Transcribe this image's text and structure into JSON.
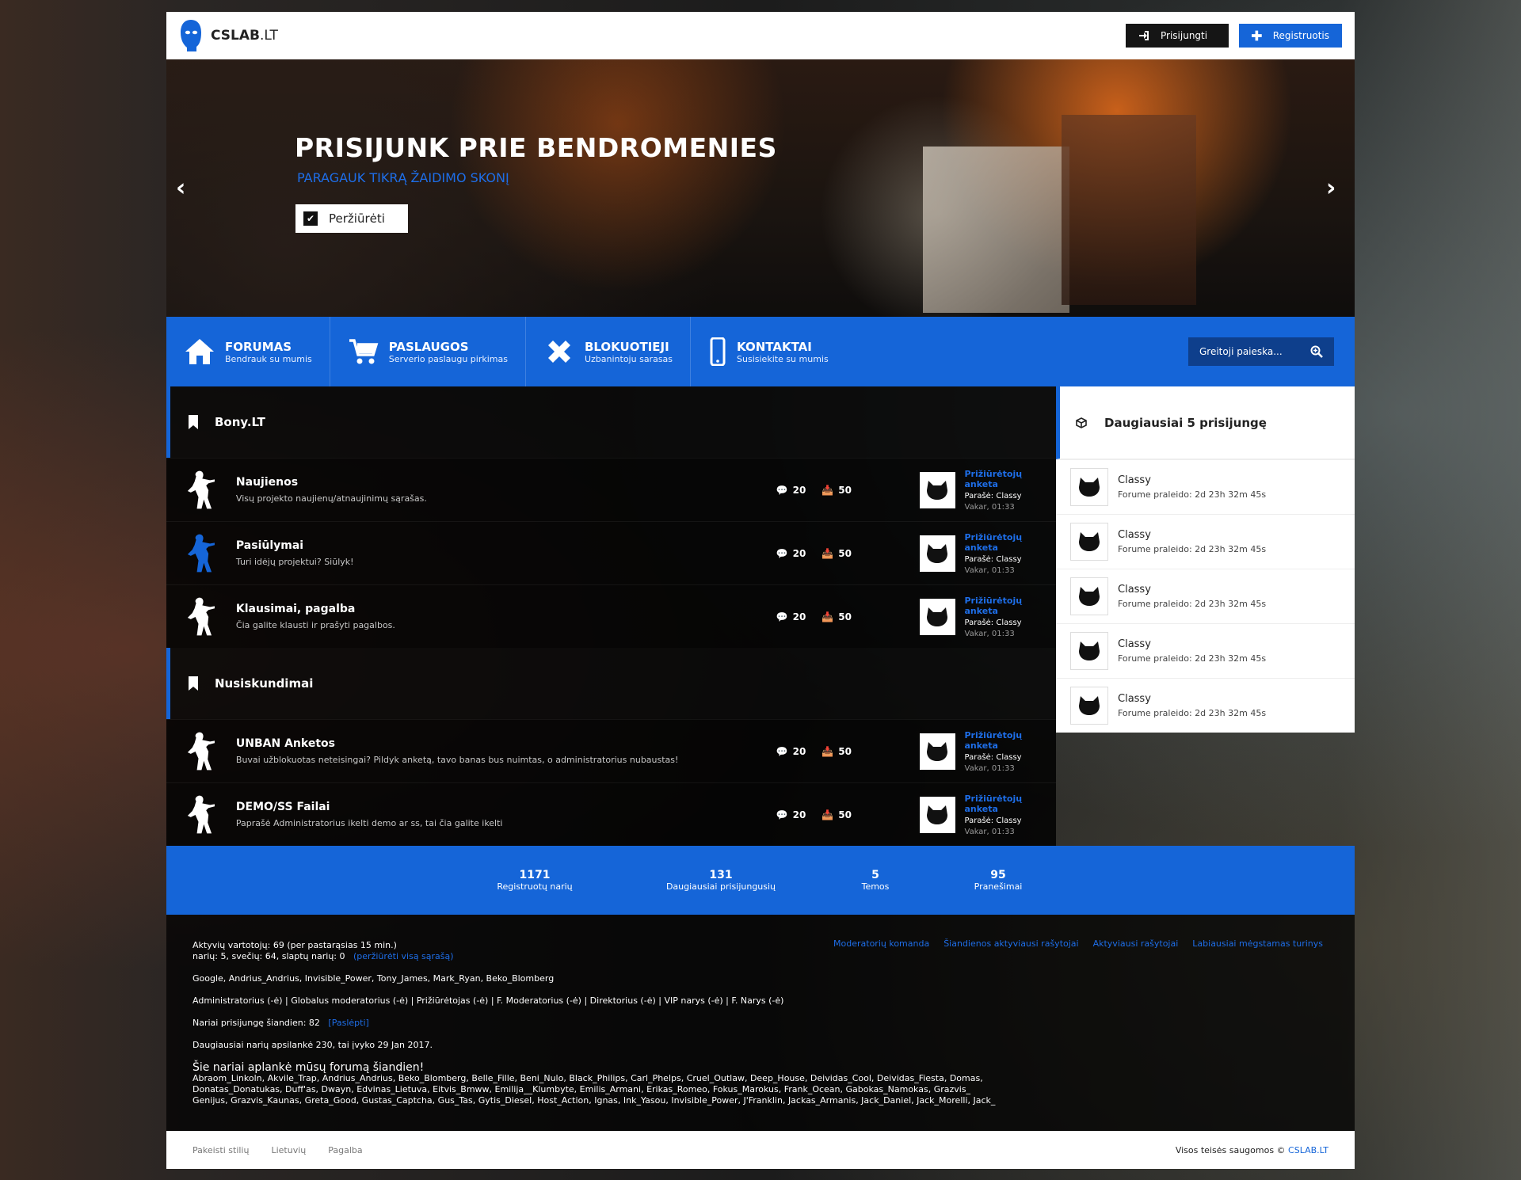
{
  "header": {
    "logo_main": "CSLAB",
    "logo_suffix": ".LT",
    "login_label": "Prisijungti",
    "register_label": "Registruotis"
  },
  "hero": {
    "title": "PRISIJUNK PRIE BENDROMENIES",
    "subtitle": "PARAGAUK TIKRĄ ŽAIDIMO SKONĮ",
    "button_label": "Peržiūrėti"
  },
  "nav": {
    "items": [
      {
        "title": "FORUMAS",
        "subtitle": "Bendrauk su mumis"
      },
      {
        "title": "PASLAUGOS",
        "subtitle": "Serverio paslaugu pirkimas"
      },
      {
        "title": "BLOKUOTIEJI",
        "subtitle": "Uzbanintoju sarasas"
      },
      {
        "title": "KONTAKTAI",
        "subtitle": "Susisiekite su mumis"
      }
    ],
    "search_placeholder": "Greitoji paieska..."
  },
  "categories": [
    {
      "title": "Bony.LT",
      "forums": [
        {
          "name": "Naujienos",
          "desc": "Visų projekto naujienų/atnaujinimų sąrašas.",
          "topics": "20",
          "posts": "50",
          "last_title": "Prižiūrėtojų anketa",
          "last_author": "Parašė: Classy",
          "last_time": "Vakar, 01:33"
        },
        {
          "name": "Pasiūlymai",
          "desc": "Turi idėjų projektui? Siūlyk!",
          "topics": "20",
          "posts": "50",
          "last_title": "Prižiūrėtojų anketa",
          "last_author": "Parašė: Classy",
          "last_time": "Vakar, 01:33"
        },
        {
          "name": "Klausimai, pagalba",
          "desc": "Čia galite klausti ir prašyti pagalbos.",
          "topics": "20",
          "posts": "50",
          "last_title": "Prižiūrėtojų anketa",
          "last_author": "Parašė: Classy",
          "last_time": "Vakar, 01:33"
        }
      ]
    },
    {
      "title": "Nusiskundimai",
      "forums": [
        {
          "name": "UNBAN Anketos",
          "desc": "Buvai užblokuotas neteisingai? Pildyk anketą, tavo banas bus nuimtas, o administratorius nubaustas!",
          "topics": "20",
          "posts": "50",
          "last_title": "Prižiūrėtojų anketa",
          "last_author": "Parašė: Classy",
          "last_time": "Vakar, 01:33"
        },
        {
          "name": "DEMO/SS Failai",
          "desc": "Paprašė Administratorius ikelti demo ar ss, tai čia galite ikelti",
          "topics": "20",
          "posts": "50",
          "last_title": "Prižiūrėtojų anketa",
          "last_author": "Parašė: Classy",
          "last_time": "Vakar, 01:33"
        }
      ]
    }
  ],
  "sidebar": {
    "title": "Daugiausiai 5 prisijungę",
    "users": [
      {
        "name": "Classy",
        "time": "Forume praleido: 2d 23h 32m 45s"
      },
      {
        "name": "Classy",
        "time": "Forume praleido: 2d 23h 32m 45s"
      },
      {
        "name": "Classy",
        "time": "Forume praleido: 2d 23h 32m 45s"
      },
      {
        "name": "Classy",
        "time": "Forume praleido: 2d 23h 32m 45s"
      },
      {
        "name": "Classy",
        "time": "Forume praleido: 2d 23h 32m 45s"
      }
    ]
  },
  "stats": [
    {
      "value": "1171",
      "label": "Registruotų narių"
    },
    {
      "value": "131",
      "label": "Daugiausiai prisijungusių"
    },
    {
      "value": "5",
      "label": "Temos"
    },
    {
      "value": "95",
      "label": "Pranešimai"
    }
  ],
  "bottom": {
    "active_line1": "Aktyvių vartotojų: 69 (per pastarąsias 15 min.)",
    "active_line2": "narių: 5, svečių: 64, slaptų narių: 0",
    "view_all": "(peržiūrėti visą sąrašą)",
    "online_users": "Google, Andrius_Andrius, Invisible_Power, Tony_James, Mark_Ryan, Beko_Blomberg",
    "groups": "Administratorius (-ė) | Globalus moderatorius (-ė) | Prižiūrėtojas (-ė) | F. Moderatorius (-ė) | Direktorius (-ė) | VIP narys (-ė) | F. Narys (-ė)",
    "today_label": "Nariai prisijungę šiandien: 82",
    "hide_label": "[Paslėpti]",
    "record": "Daugiausiai narių apsilankė 230, tai įvyko 29 Jan 2017.",
    "visited_title": "Šie nariai aplankė mūsų forumą šiandien!",
    "visited_list": "Abraom_Linkoln, Akvile_Trap, Andrius_Andrius, Beko_Blomberg, Belle_Fille, Beni_Nulo, Black_Philips, Carl_Phelps, Cruel_Outlaw, Deep_House, Deividas_Cool, Deividas_Fiesta, Domas, Donatas_Donatukas, Duff'as, Dwayn, Edvinas_Lietuva, Eitvis_Bmww, Emilija__Klumbyte, Emilis_Armani, Erikas_Romeo, Fokus_Marokus, Frank_Ocean, Gabokas_Namokas, Grazvis_ Genijus, Grazvis_Kaunas, Greta_Good, Gustas_Captcha, Gus_Tas, Gytis_Diesel, Host_Action, Ignas, Ink_Yasou, Invisible_Power, J'Franklin, Jackas_Armanis, Jack_Daniel, Jack_Morelli, Jack_",
    "links": [
      "Moderatorių komanda",
      "Šiandienos aktyviausi rašytojai",
      "Aktyviausi rašytojai",
      "Labiausiai mėgstamas turinys"
    ]
  },
  "footer": {
    "links": [
      "Pakeisti stilių",
      "Lietuvių",
      "Pagalba"
    ],
    "copyright": "Visos teisės saugomos © ",
    "brand": "CSLAB.LT"
  }
}
